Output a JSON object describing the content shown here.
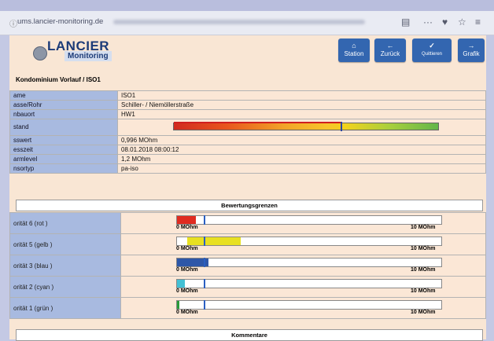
{
  "browser": {
    "url": "ums.lancier-monitoring.de"
  },
  "logo": {
    "name": "LANCIER",
    "sub": "Monitoring"
  },
  "nav": [
    {
      "label": "Station",
      "icon": "home"
    },
    {
      "label": "Zurück",
      "icon": "arrow-left"
    },
    {
      "label": "Quittieren",
      "icon": "check"
    },
    {
      "label": "Grafik",
      "icon": "arrow-right"
    }
  ],
  "breadcrumb": "Kondominium Vorlauf / ISO1",
  "info": [
    {
      "key": "ame",
      "value": "ISO1"
    },
    {
      "key": "asse/Rohr",
      "value": "Schiller- / Niemöllerstraße"
    },
    {
      "key": "nbauort",
      "value": "HW1"
    },
    {
      "key": "stand",
      "value": ""
    },
    {
      "key": "sswert",
      "value": "0,996 MOhm"
    },
    {
      "key": "esszeit",
      "value": "08.01.2018 08:00:12"
    },
    {
      "key": "armlevel",
      "value": "1,2 MOhm"
    },
    {
      "key": "nsortyp",
      "value": "pa-iso"
    }
  ],
  "zustand_level": 0.63,
  "sections": {
    "limits": "Bewertungsgrenzen",
    "comments": "Kommentare"
  },
  "priorities": [
    {
      "label": "orität 6 (rot )",
      "color": "#e02b20",
      "from": 0.0,
      "to": 0.07
    },
    {
      "label": "orität 5 (gelb )",
      "color": "#e8e021",
      "from": 0.04,
      "to": 0.24
    },
    {
      "label": "orität 3 (blau )",
      "color": "#2e57a8",
      "from": 0.0,
      "to": 0.12
    },
    {
      "label": "orität 2 (cyan )",
      "color": "#43c0d4",
      "from": 0.0,
      "to": 0.03
    },
    {
      "label": "orität 1 (grün )",
      "color": "#2a9a39",
      "from": 0.0,
      "to": 0.01
    }
  ],
  "gauge": {
    "min": "0 MOhm",
    "max": "10 MOhm"
  }
}
